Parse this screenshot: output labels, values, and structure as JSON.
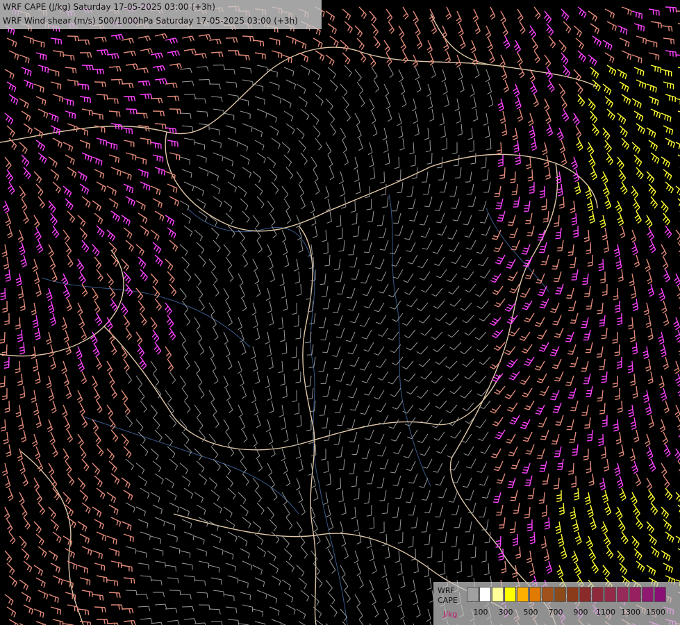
{
  "titles": {
    "line1": "WRF CAPE (J/kg) Saturday 17-05-2025 03:00 (+3h)",
    "line2": "WRF Wind shear (m/s) 500/1000hPa Saturday 17-05-2025 03:00 (+3h)"
  },
  "legend": {
    "caption_line1": "WRF",
    "caption_line2": "CAPE",
    "unit": "J/kg",
    "colors": [
      "#a0a0a0",
      "#ffffff",
      "#ffff99",
      "#ffff00",
      "#ffb000",
      "#e07a00",
      "#a0521a",
      "#8c4a1a",
      "#8b3a1a",
      "#8a2a2a",
      "#8f2a3c",
      "#942a4a",
      "#962a58",
      "#962060",
      "#901870",
      "#8a1075"
    ],
    "ticks": [
      "100",
      "300",
      "500",
      "700",
      "900",
      "1100",
      "1300",
      "1500"
    ]
  },
  "wind_colors": {
    "strong": "#ff44ff",
    "moderate": "#e28a7a",
    "weak": "#9a9a9a",
    "very_strong": "#ffff33"
  },
  "map_colors": {
    "border": "#e0c8a8",
    "river": "#3a5a8a"
  }
}
